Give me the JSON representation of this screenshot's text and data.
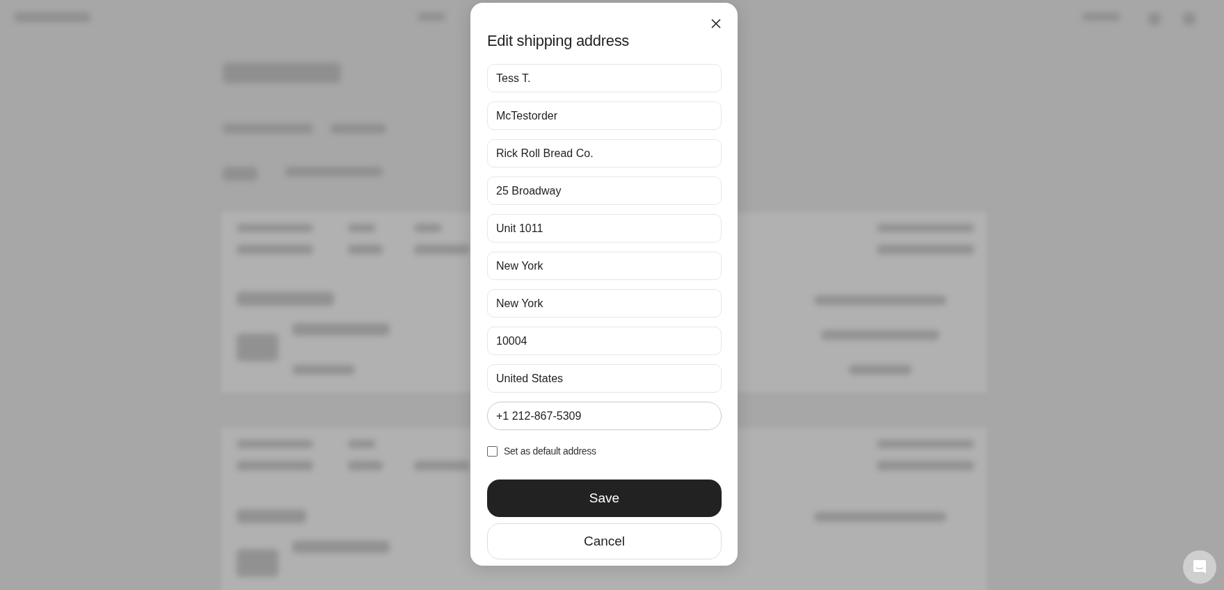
{
  "dialog": {
    "title": "Edit shipping address",
    "fields": [
      {
        "value": "Tess T.",
        "focused": false
      },
      {
        "value": "McTestorder",
        "focused": false
      },
      {
        "value": "Rick Roll Bread Co.",
        "focused": false
      },
      {
        "value": "25 Broadway",
        "focused": false
      },
      {
        "value": "Unit 1011",
        "focused": false
      },
      {
        "value": "New York",
        "focused": false
      },
      {
        "value": "New York",
        "focused": false
      },
      {
        "value": "10004",
        "focused": false
      },
      {
        "value": "United States",
        "focused": false
      },
      {
        "value": "+1 212-867-5309",
        "focused": true
      }
    ],
    "default_checkbox": {
      "label": "Set as default address",
      "checked": false
    },
    "buttons": [
      {
        "label": "Save",
        "kind": "primary"
      },
      {
        "label": "Cancel",
        "kind": "secondary"
      }
    ]
  }
}
